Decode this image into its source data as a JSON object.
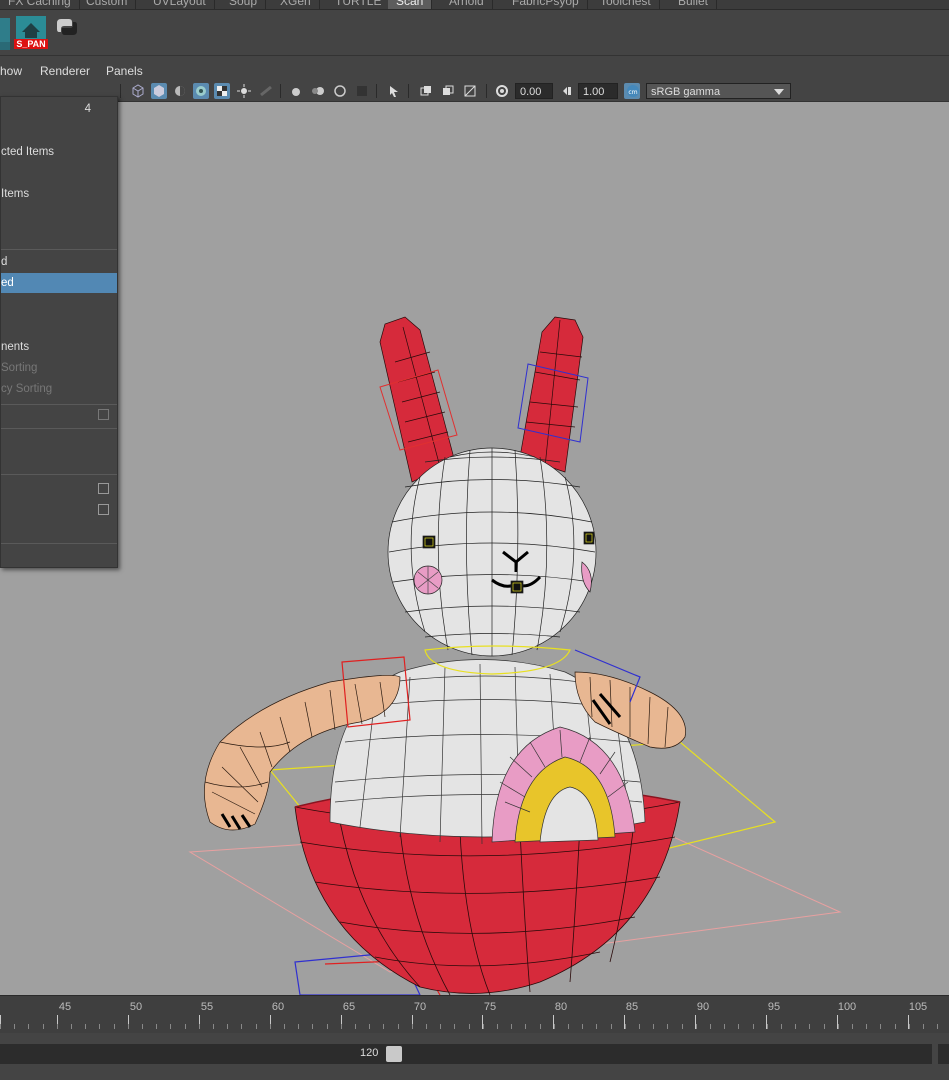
{
  "shelf_tabs": [
    "FX Caching",
    "Custom",
    "UVLayout",
    "Soup",
    "XGen",
    "TURTLE",
    "Scan",
    "Arnold",
    "FabricPsyop",
    "Toolchest",
    "Bullet"
  ],
  "shelf_tabs_active": "Scan",
  "shelf": {
    "buttons": [
      {
        "icon": "house-icon",
        "label": "S_PAN"
      },
      {
        "icon": "python-icon",
        "label": ""
      }
    ]
  },
  "panel_menu": [
    "Show",
    "Renderer",
    "Panels"
  ],
  "panel_menu_display": [
    "how",
    "Renderer",
    "Panels"
  ],
  "toolbar": {
    "exposure": "0.00",
    "gamma": "1.00",
    "color_space": "sRGB gamma"
  },
  "popup_menu": {
    "items": [
      {
        "label": "4",
        "type": "number"
      },
      {
        "label": "cted Items",
        "type": "item"
      },
      {
        "label": "Items",
        "type": "item"
      },
      {
        "label": "d",
        "type": "item"
      },
      {
        "label": "ed",
        "type": "highlight"
      },
      {
        "label": "nents",
        "type": "item"
      },
      {
        "label": "Sorting",
        "type": "disabled"
      },
      {
        "label": "cy Sorting",
        "type": "disabled"
      }
    ]
  },
  "time_slider": {
    "ticks": [
      "45",
      "50",
      "55",
      "60",
      "65",
      "70",
      "75",
      "80",
      "85",
      "90",
      "95",
      "100",
      "105"
    ]
  },
  "range_slider": {
    "end_value": "120"
  },
  "colors": {
    "viewport_bg": "#a0a0a0",
    "menu_highlight": "#5288b4",
    "bunny_red": "#d62a3b",
    "bunny_skin": "#e8b792",
    "bunny_body": "#e4e4e4",
    "rainbow_pink": "#e89cc5",
    "rainbow_yellow": "#e8c52a"
  }
}
